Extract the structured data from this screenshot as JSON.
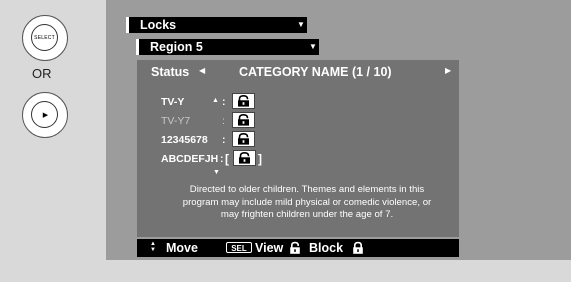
{
  "remote": {
    "select_label": "SELECT",
    "or_label": "OR",
    "select_button_icon": "select-circle-icon",
    "right_button_icon": "right-arrow-circle-icon"
  },
  "menu": {
    "locks_label": "Locks",
    "region_label": "Region 5",
    "dropdown_icon": "triangle-down-icon"
  },
  "status_row": {
    "label": "Status",
    "category": "CATEGORY NAME (1 / 10)"
  },
  "ratings": [
    {
      "name": "TV-Y",
      "locked": false
    },
    {
      "name": "TV-Y7",
      "locked": false
    },
    {
      "name": "12345678",
      "locked": false
    },
    {
      "name": "ABCDEFJH",
      "locked": false
    }
  ],
  "description": "Directed to older children. Themes and elements in this program may include mild physical or comedic violence, or may frighten children under the age of 7.",
  "legend": {
    "move_label": "Move",
    "sel_badge": "SEL",
    "view_label": "View",
    "block_label": "Block"
  },
  "colors": {
    "osd_bg": "#9c9c9c",
    "panel_bg": "#737373",
    "bar_bg": "#000000",
    "side_bg": "#d9d9d9"
  }
}
